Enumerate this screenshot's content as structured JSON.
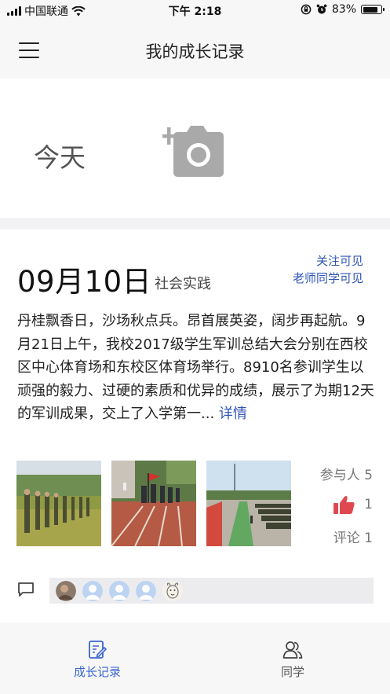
{
  "status_bar": {
    "carrier": "中国联通",
    "time": "下午 2:18",
    "battery_percent": "83%",
    "battery_level": 0.83,
    "icons": [
      "signal-icon",
      "wifi-icon",
      "orientation-lock-icon",
      "alarm-icon",
      "battery-icon"
    ]
  },
  "navbar": {
    "title": "我的成长记录",
    "menu_icon": "hamburger-menu-icon"
  },
  "today": {
    "label": "今天",
    "add_photo_icon": "camera-plus-icon"
  },
  "post": {
    "date": "09月10日",
    "category": "社会实践",
    "visibility": [
      "关注可见",
      "老师同学可见"
    ],
    "body": "丹桂飘香日，沙场秋点兵。昂首展英姿，阔步再起航。9月21日上午，我校2017级学生军训总结大会分别在西校区中心体育场和东校区体育场举行。8910名参训学生以顽强的毅力、过硬的素质和优异的成绩，展示了为期12天的军训成果，交上了入学第一...",
    "more_link": "详情",
    "photos": [
      "military-march-photo",
      "flag-parade-photo",
      "stadium-assembly-photo"
    ],
    "participants": "参与人 5",
    "likes": "1",
    "comments": "评论 1",
    "like_icon": "thumbs-up-icon",
    "comment_icon": "comment-icon",
    "avatar_count": 5
  },
  "tabbar": {
    "tabs": [
      {
        "label": "成长记录",
        "icon": "edit-note-icon",
        "active": true
      },
      {
        "label": "同学",
        "icon": "people-icon",
        "active": false
      }
    ]
  },
  "colors": {
    "accent": "#3a66cf",
    "link": "#2f55b5",
    "like": "#e0484f",
    "background": "#f2f2f4"
  }
}
